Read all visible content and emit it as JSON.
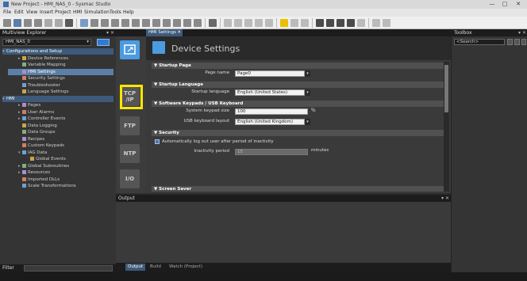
{
  "window": {
    "title": "New Project - HMI_NAS_0 - Sysmac Studio",
    "minimize": "—",
    "maximize": "□",
    "close": "✕"
  },
  "menu": [
    "File",
    "Edit",
    "View",
    "Insert",
    "Project",
    "HMI",
    "Simulation",
    "Tools",
    "Help"
  ],
  "explorer": {
    "title": "Multiview Explorer",
    "header_buttons": "▾ ✕",
    "device": "HMI_NAS_0",
    "tree": [
      {
        "label": "Configurations and Setup",
        "type": "group",
        "twisty": "▾"
      },
      {
        "label": "Device References",
        "indent": 1,
        "twisty": "▸"
      },
      {
        "label": "Variable Mapping",
        "indent": 1,
        "twisty": ""
      },
      {
        "label": "HMI Settings",
        "indent": 1,
        "twisty": "",
        "selected": true
      },
      {
        "label": "Security Settings",
        "indent": 1,
        "twisty": ""
      },
      {
        "label": "Troubleshooter",
        "indent": 1,
        "twisty": ""
      },
      {
        "label": "Language Settings",
        "indent": 1,
        "twisty": ""
      },
      {
        "label": "HMI",
        "type": "group",
        "twisty": "▾"
      },
      {
        "label": "Pages",
        "indent": 1,
        "twisty": "▸"
      },
      {
        "label": "User Alarms",
        "indent": 1,
        "twisty": "▸"
      },
      {
        "label": "Controller Events",
        "indent": 1,
        "twisty": "▸"
      },
      {
        "label": "Data Logging",
        "indent": 1,
        "twisty": ""
      },
      {
        "label": "Data Groups",
        "indent": 1,
        "twisty": ""
      },
      {
        "label": "Recipes",
        "indent": 1,
        "twisty": ""
      },
      {
        "label": "Custom Keypads",
        "indent": 1,
        "twisty": ""
      },
      {
        "label": "IAG Data",
        "indent": 1,
        "twisty": "▾"
      },
      {
        "label": "Global Events",
        "indent": 2,
        "twisty": ""
      },
      {
        "label": "Global Subroutines",
        "indent": 1,
        "twisty": "▸"
      },
      {
        "label": "Resources",
        "indent": 1,
        "twisty": "▸"
      },
      {
        "label": "Imported DLLs",
        "indent": 1,
        "twisty": ""
      },
      {
        "label": "Scale Transformations",
        "indent": 1,
        "twisty": ""
      }
    ],
    "filter_label": "Filter"
  },
  "editor": {
    "tab_label": "HMI Settings",
    "tab_close": "✕",
    "title": "Device Settings",
    "categories": [
      {
        "name": "device",
        "label": ""
      },
      {
        "name": "tcpip",
        "label": "TCP\n/IP"
      },
      {
        "name": "ftp",
        "label": "FTP"
      },
      {
        "name": "ntp",
        "label": "NTP"
      },
      {
        "name": "io",
        "label": "I/O"
      }
    ],
    "sections": {
      "startup_page": "▼ Startup Page",
      "startup_language": "▼ Startup Language",
      "keypads": "▼ Software Keypads / USB Keyboard",
      "security": "▼ Security",
      "screen_saver": "▼ Screen Saver"
    },
    "fields": {
      "page_name_label": "Page name",
      "page_name_value": "Page0",
      "startup_language_label": "Startup language",
      "startup_language_value": "English (United States)",
      "keypad_size_label": "System keypad size",
      "keypad_size_value": "100",
      "keypad_size_unit": "%",
      "usb_layout_label": "USB keyboard layout",
      "usb_layout_value": "English (United Kingdom)",
      "auto_logout_label": "Automatically log out user after period of inactivity",
      "inactivity_label": "Inactivity period",
      "inactivity_value": "15",
      "inactivity_unit": "minutes",
      "dropdown_arrow": "▾"
    }
  },
  "output": {
    "title": "Output",
    "header_buttons": "▾ ✕",
    "tabs": [
      "Output",
      "Build",
      "Watch (Project)"
    ]
  },
  "toolbox": {
    "title": "Toolbox",
    "header_buttons": "▾ ✕",
    "search_placeholder": "<Search>"
  }
}
